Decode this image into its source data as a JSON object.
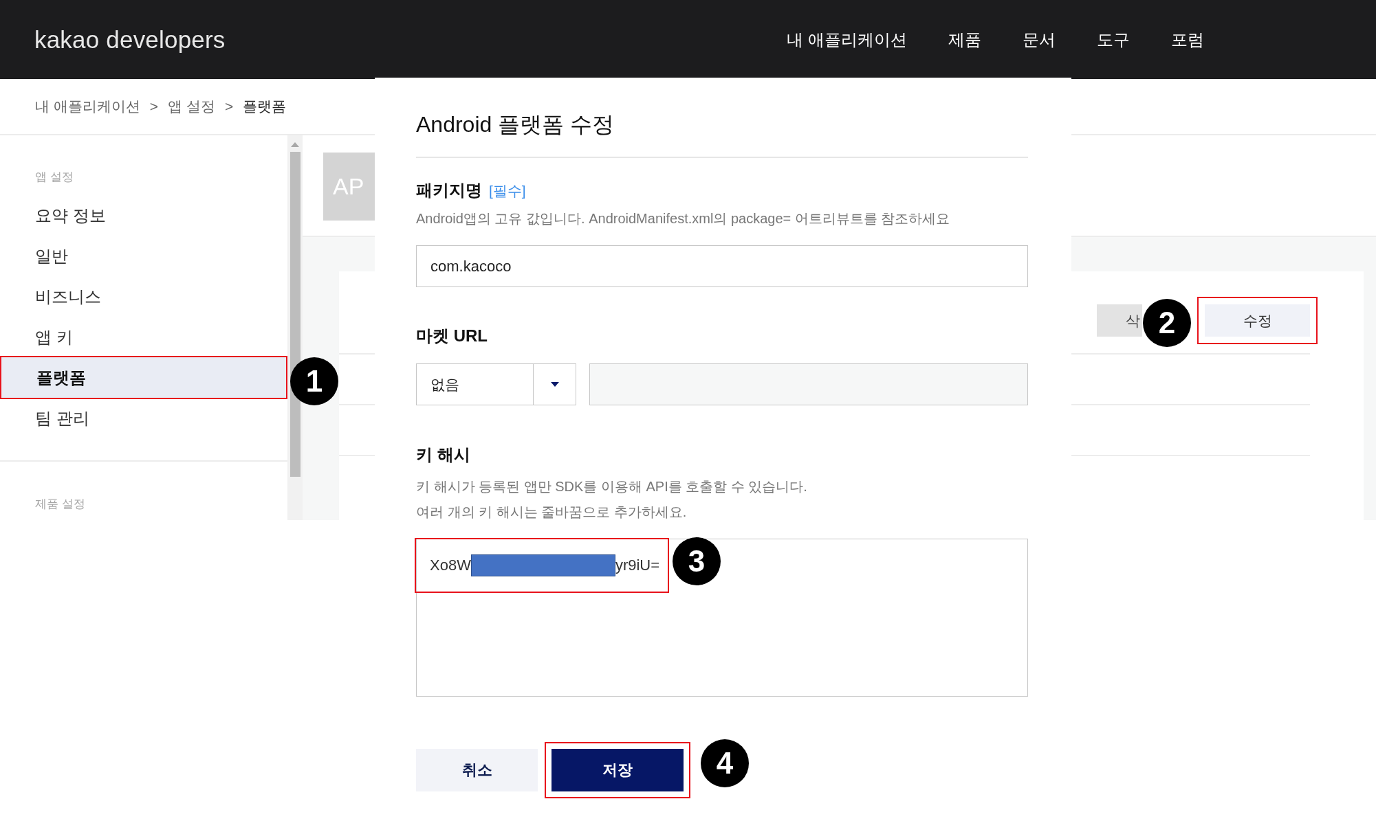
{
  "header": {
    "logo": "kakao developers",
    "nav": [
      {
        "label": "내 애플리케이션"
      },
      {
        "label": "제품"
      },
      {
        "label": "문서"
      },
      {
        "label": "도구"
      },
      {
        "label": "포럼"
      }
    ]
  },
  "breadcrumb": [
    {
      "kind": "link",
      "text": "내 애플리케이션"
    },
    {
      "kind": "separator",
      "text": ">"
    },
    {
      "kind": "link",
      "text": "앱 설정"
    },
    {
      "kind": "separator",
      "text": ">"
    },
    {
      "kind": "current",
      "text": "플랫폼"
    }
  ],
  "sidebar": {
    "sections": [
      {
        "title": "앱 설정",
        "items": [
          {
            "label": "요약 정보",
            "selected": false,
            "highlighted": false
          },
          {
            "label": "일반",
            "selected": false,
            "highlighted": false
          },
          {
            "label": "비즈니스",
            "selected": false,
            "highlighted": false
          },
          {
            "label": "앱 키",
            "selected": false,
            "highlighted": false
          },
          {
            "label": "플랫폼",
            "selected": true,
            "highlighted": true
          },
          {
            "label": "팀 관리",
            "selected": false,
            "highlighted": false
          }
        ]
      },
      {
        "title": "제품 설정"
      }
    ]
  },
  "app_tile": {
    "text": "AP"
  },
  "platform_card": {
    "buttons": [
      {
        "label": "삭",
        "kind": "secondary",
        "highlighted": false
      },
      {
        "label": "수정",
        "kind": "primary",
        "highlighted": true
      }
    ]
  },
  "dialog": {
    "title": "Android 플랫폼 수정",
    "fields": [
      {
        "kind": "text",
        "label": "패키지명",
        "required_tag": "[필수]",
        "help": [
          "Android앱의 고유 값입니다. AndroidManifest.xml의 package= 어트리뷰트를 참조하세요"
        ],
        "value": "com.kacoco"
      },
      {
        "kind": "select",
        "label": "마켓 URL",
        "option": "없음"
      },
      {
        "kind": "keyhash",
        "label": "키 해시",
        "help": [
          "키 해시가 등록된 앱만 SDK를 이용해 API를 호출할 수 있습니다.",
          "여러 개의 키 해시는 줄바꿈으로 추가하세요."
        ],
        "prefix": "Xo8W",
        "suffix": "yr9iU=",
        "redacted": true,
        "highlighted": true
      }
    ],
    "buttons": [
      {
        "label": "취소",
        "kind": "secondary",
        "highlighted": false
      },
      {
        "label": "저장",
        "kind": "primary",
        "highlighted": true
      }
    ]
  },
  "annotations": [
    {
      "number": "1"
    },
    {
      "number": "2"
    },
    {
      "number": "3"
    },
    {
      "number": "4"
    }
  ]
}
